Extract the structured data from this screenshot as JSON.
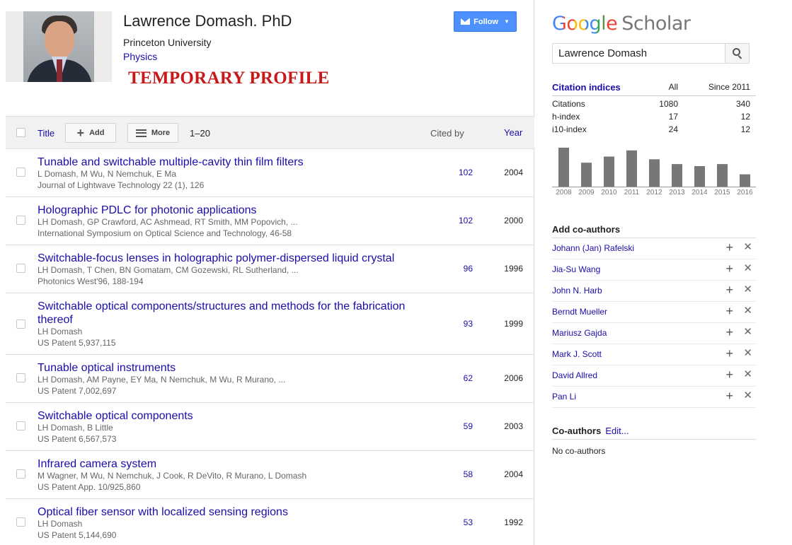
{
  "profile": {
    "name": "Lawrence Domash. PhD",
    "affiliation": "Princeton University",
    "field": "Physics",
    "banner": "TEMPORARY PROFILE",
    "follow_label": "Follow"
  },
  "table": {
    "title_label": "Title",
    "add_label": "Add",
    "more_label": "More",
    "range": "1–20",
    "cited_by_label": "Cited by",
    "year_label": "Year"
  },
  "articles": [
    {
      "title": "Tunable and switchable multiple-cavity thin film filters",
      "authors": "L Domash, M Wu, N Nemchuk, E Ma",
      "venue": "Journal of Lightwave Technology 22 (1), 126",
      "cited_by": "102",
      "year": "2004"
    },
    {
      "title": "Holographic PDLC for photonic applications",
      "authors": "LH Domash, GP Crawford, AC Ashmead, RT Smith, MM Popovich, ...",
      "venue": "International Symposium on Optical Science and Technology, 46-58",
      "cited_by": "102",
      "year": "2000"
    },
    {
      "title": "Switchable-focus lenses in holographic polymer-dispersed liquid crystal",
      "authors": "LH Domash, T Chen, BN Gomatam, CM Gozewski, RL Sutherland, ...",
      "venue": "Photonics West'96, 188-194",
      "cited_by": "96",
      "year": "1996"
    },
    {
      "title": "Switchable optical components/structures and methods for the fabrication thereof",
      "authors": "LH Domash",
      "venue": "US Patent 5,937,115",
      "cited_by": "93",
      "year": "1999"
    },
    {
      "title": "Tunable optical instruments",
      "authors": "LH Domash, AM Payne, EY Ma, N Nemchuk, M Wu, R Murano, ...",
      "venue": "US Patent 7,002,697",
      "cited_by": "62",
      "year": "2006"
    },
    {
      "title": "Switchable optical components",
      "authors": "LH Domash, B Little",
      "venue": "US Patent 6,567,573",
      "cited_by": "59",
      "year": "2003"
    },
    {
      "title": "Infrared camera system",
      "authors": "M Wagner, M Wu, N Nemchuk, J Cook, R DeVito, R Murano, L Domash",
      "venue": "US Patent App. 10/925,860",
      "cited_by": "58",
      "year": "2004"
    },
    {
      "title": "Optical fiber sensor with localized sensing regions",
      "authors": "LH Domash",
      "venue": "US Patent 5,144,690",
      "cited_by": "53",
      "year": "1992"
    }
  ],
  "sidebar": {
    "logo_google": "Google",
    "logo_scholar": "Scholar",
    "search_value": "Lawrence Domash",
    "citation_header": "Citation indices",
    "col_all": "All",
    "col_since": "Since 2011",
    "indices": [
      {
        "label": "Citations",
        "all": "1080",
        "since": "340"
      },
      {
        "label": "h-index",
        "all": "17",
        "since": "12"
      },
      {
        "label": "i10-index",
        "all": "24",
        "since": "12"
      }
    ],
    "add_coauthors_title": "Add co-authors",
    "suggested_coauthors": [
      "Johann (Jan) Rafelski",
      "Jia-Su Wang",
      "John N. Harb",
      "Berndt Mueller",
      "Mariusz Gajda",
      "Mark J. Scott",
      "David Allred",
      "Pan Li"
    ],
    "coauthors_title": "Co-authors",
    "edit_label": "Edit...",
    "no_coauthors": "No co-authors"
  },
  "colors": {
    "link": "#1a0dab",
    "follow_button": "#4d90fe",
    "banner": "#c71919",
    "bar": "#777777"
  },
  "chart_data": {
    "type": "bar",
    "categories": [
      "2008",
      "2009",
      "2010",
      "2011",
      "2012",
      "2013",
      "2014",
      "2015",
      "2016"
    ],
    "values": [
      57,
      35,
      44,
      53,
      40,
      33,
      30,
      33,
      18
    ],
    "ylim": [
      0,
      60
    ],
    "xlabel": "",
    "ylabel": "",
    "title": ""
  }
}
